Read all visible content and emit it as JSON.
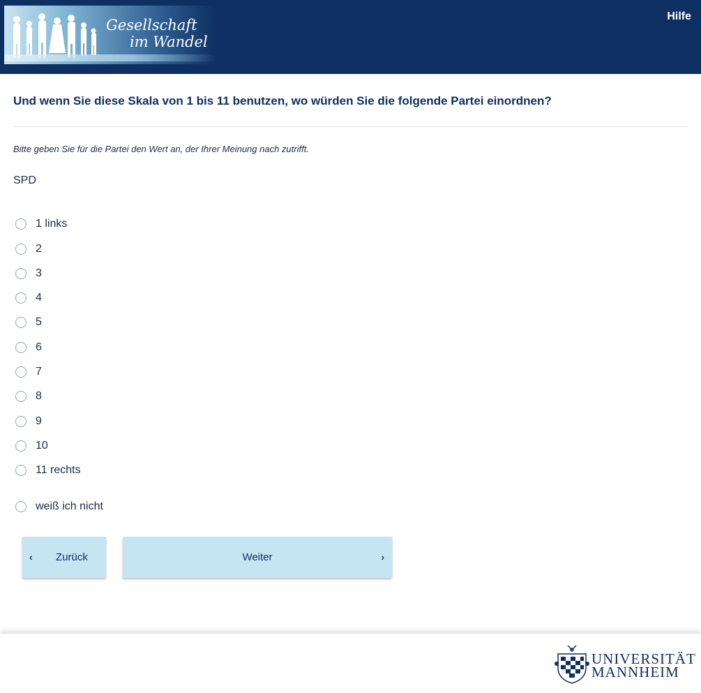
{
  "header": {
    "logo_line1": "Gesellschaft",
    "logo_line2": "im Wandel",
    "help_label": "Hilfe"
  },
  "question": {
    "title": "Und wenn Sie diese Skala von 1 bis 11 benutzen, wo würden Sie die folgende Partei einordnen?",
    "instruction": "Bitte geben Sie für die Partei den Wert an, der Ihrer Meinung nach zutrifft.",
    "item": "SPD"
  },
  "options": [
    "1 links",
    "2",
    "3",
    "4",
    "5",
    "6",
    "7",
    "8",
    "9",
    "10",
    "11 rechts",
    "weiß ich nicht"
  ],
  "nav": {
    "back_label": "Zurück",
    "next_label": "Weiter"
  },
  "footer": {
    "uni_line1": "UNIVERSITÄT",
    "uni_line2": "MANNHEIM"
  },
  "colors": {
    "header_bg": "#0d2f61",
    "button_bg": "#c6e5f3"
  }
}
